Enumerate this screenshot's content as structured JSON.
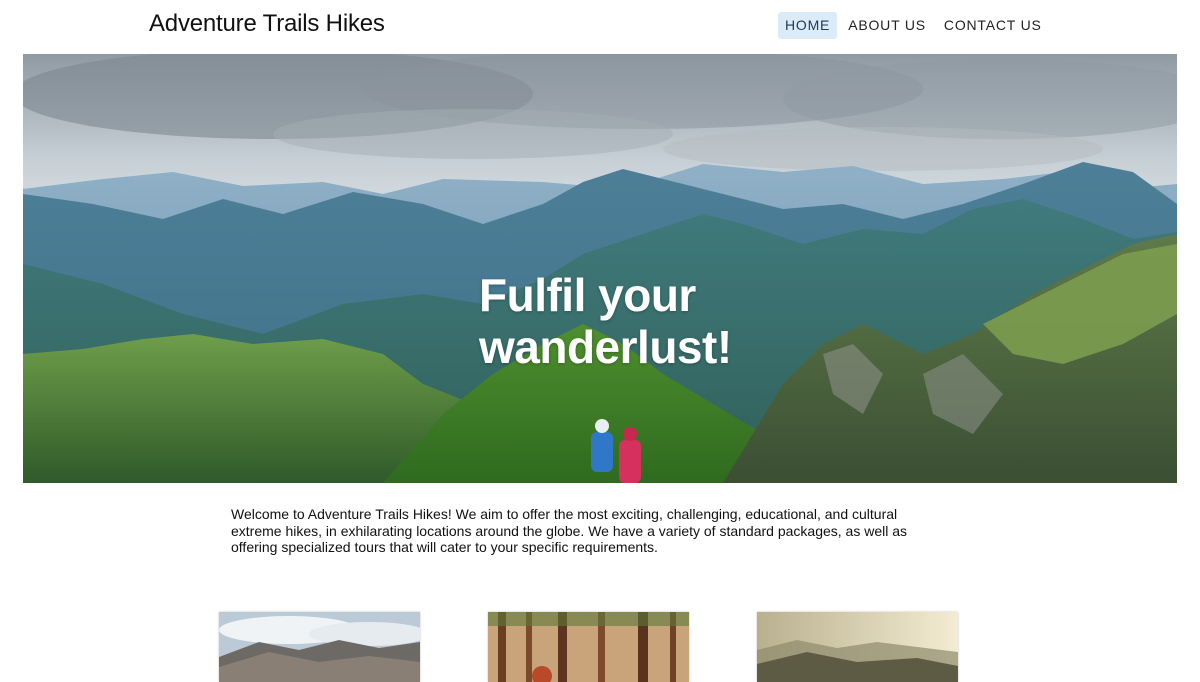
{
  "header": {
    "site_title": "Adventure Trails Hikes",
    "nav": [
      {
        "label": "HOME",
        "active": true
      },
      {
        "label": "ABOUT US",
        "active": false
      },
      {
        "label": "CONTACT US",
        "active": false
      }
    ]
  },
  "hero": {
    "heading_line1": "Fulfil your",
    "heading_line2": "wanderlust!"
  },
  "intro": {
    "text": "Welcome to Adventure Trails Hikes! We aim to offer the most exciting, challenging, educational, and cultural extreme hikes, in exhilarating locations around the globe. We have a variety of standard packages, as well as offering specialized tours that will cater to your specific requirements."
  },
  "colors": {
    "nav_active_bg": "#dbecf8",
    "hero_text": "#ffffff"
  }
}
